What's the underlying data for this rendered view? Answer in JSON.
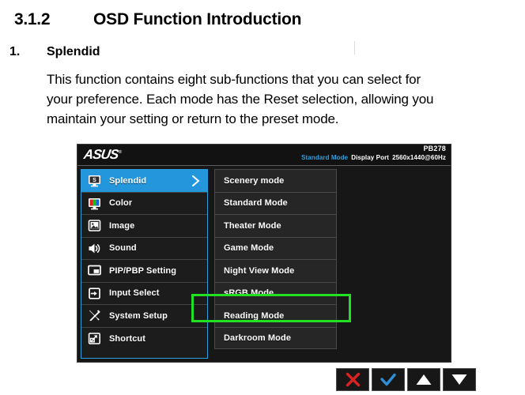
{
  "document": {
    "section_number": "3.1.2",
    "section_title": "OSD Function Introduction",
    "item_number": "1.",
    "item_title": "Splendid",
    "paragraph_lines": [
      "This function contains eight sub-functions that you can select for",
      "your preference. Each mode has the Reset selection, allowing you",
      "maintain your setting or return to the preset mode."
    ]
  },
  "osd": {
    "brand": "ASUS",
    "model": "PB278",
    "status": {
      "mode": "Standard Mode",
      "source": "Display Port",
      "resolution": "2560x1440@60Hz"
    },
    "accent_blue": "#2396dc",
    "highlight_green": "#22e022",
    "sidebar": [
      {
        "label": "Splendid",
        "icon": "splendid-monitor-icon",
        "active": true,
        "has_arrow": true
      },
      {
        "label": "Color",
        "icon": "color-bars-icon",
        "active": false,
        "has_arrow": false
      },
      {
        "label": "Image",
        "icon": "image-picture-icon",
        "active": false,
        "has_arrow": false
      },
      {
        "label": "Sound",
        "icon": "speaker-icon",
        "active": false,
        "has_arrow": false
      },
      {
        "label": "PIP/PBP Setting",
        "icon": "pip-pbp-icon",
        "active": false,
        "has_arrow": false
      },
      {
        "label": "Input Select",
        "icon": "input-arrow-icon",
        "active": false,
        "has_arrow": false
      },
      {
        "label": "System Setup",
        "icon": "wrench-screwdriver-icon",
        "active": false,
        "has_arrow": false
      },
      {
        "label": "Shortcut",
        "icon": "shortcut-squares-icon",
        "active": false,
        "has_arrow": false
      }
    ],
    "submenu": [
      {
        "label": "Scenery mode",
        "highlighted": false
      },
      {
        "label": "Standard Mode",
        "highlighted": false
      },
      {
        "label": "Theater Mode",
        "highlighted": false
      },
      {
        "label": "Game Mode",
        "highlighted": false
      },
      {
        "label": "Night View Mode",
        "highlighted": false
      },
      {
        "label": "sRGB Mode",
        "highlighted": true
      },
      {
        "label": "Reading Mode",
        "highlighted": false
      },
      {
        "label": "Darkroom Mode",
        "highlighted": false
      }
    ],
    "buttons": [
      {
        "name": "close-button",
        "icon": "cross-icon",
        "color": "#d92323"
      },
      {
        "name": "confirm-button",
        "icon": "checkmark-icon",
        "color": "#2e8fd6"
      },
      {
        "name": "up-button",
        "icon": "triangle-up-icon",
        "color": "#ffffff"
      },
      {
        "name": "down-button",
        "icon": "triangle-down-icon",
        "color": "#ffffff"
      }
    ]
  }
}
